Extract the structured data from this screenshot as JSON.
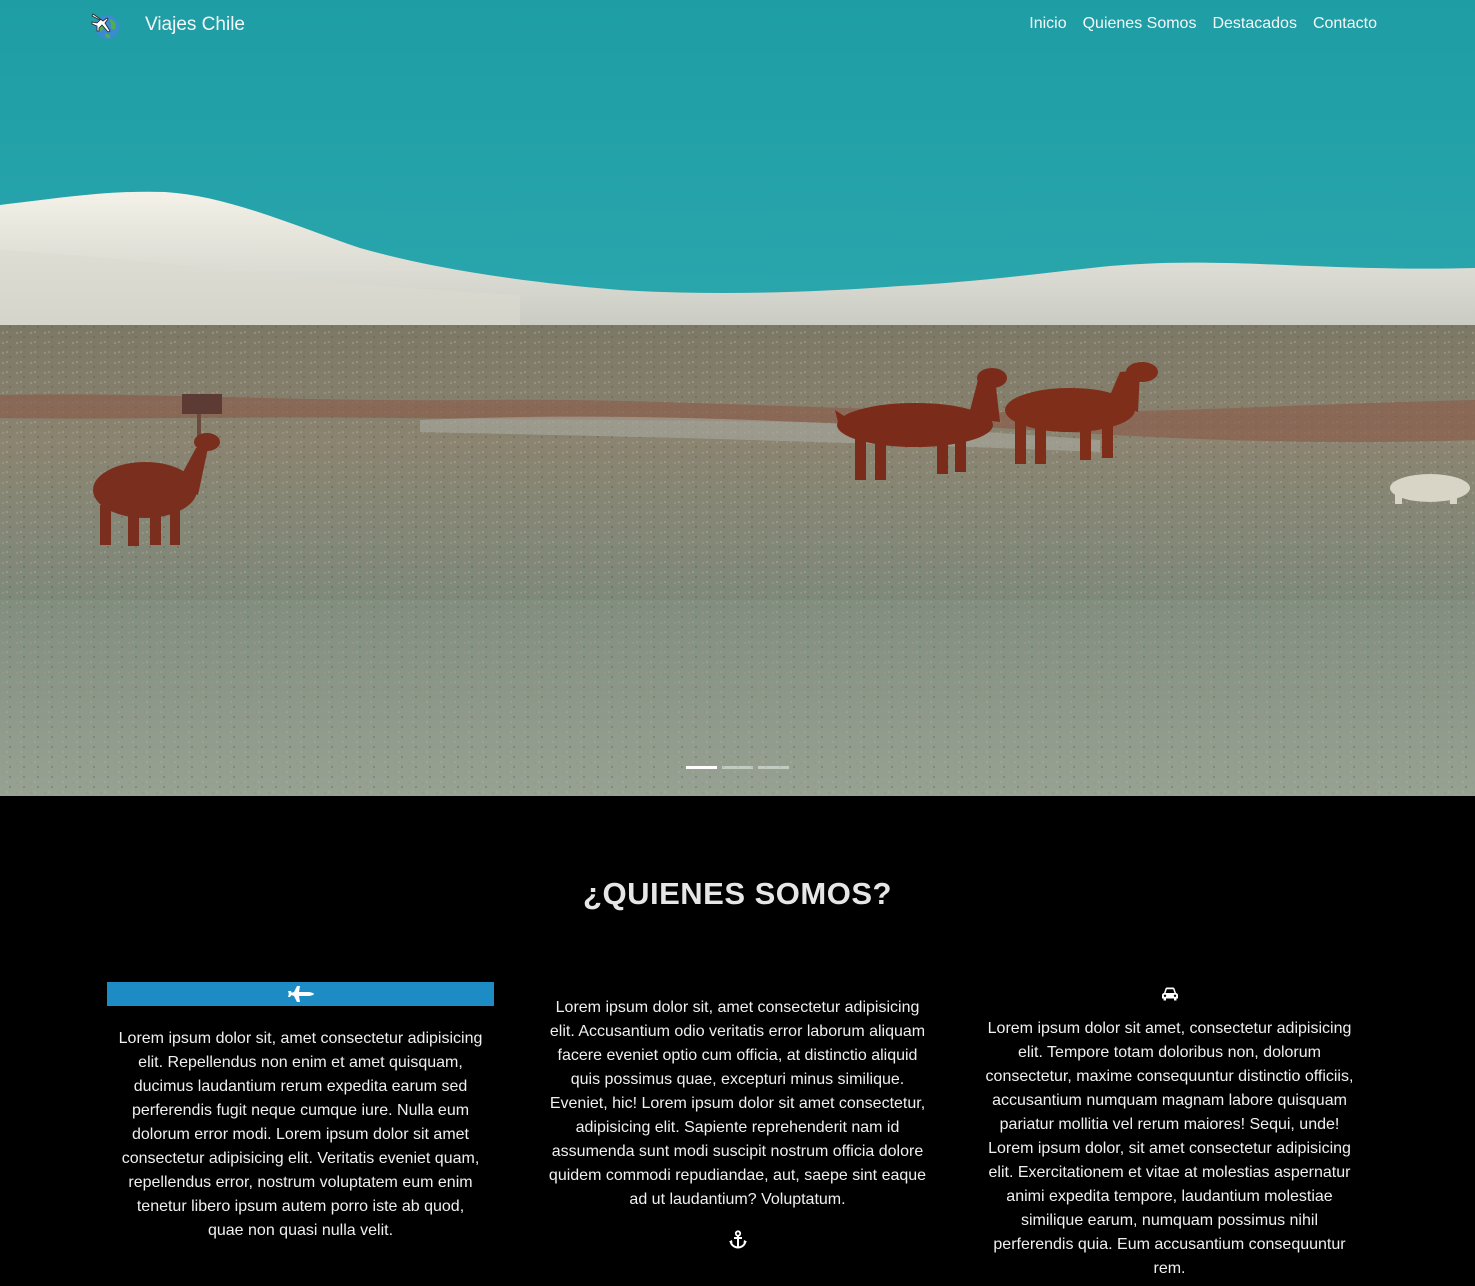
{
  "brand": {
    "name": "Viajes Chile",
    "logo": "globe-airplane-logo"
  },
  "nav": {
    "items": [
      {
        "label": "Inicio"
      },
      {
        "label": "Quienes Somos"
      },
      {
        "label": "Destacados"
      },
      {
        "label": "Contacto"
      }
    ]
  },
  "carousel": {
    "slide_count": 3,
    "active_index": 0,
    "image": "llamas-in-altiplano-photo"
  },
  "about": {
    "title": "¿QUIENES SOMOS?",
    "accent_color": "#1e8cc4",
    "columns": [
      {
        "icon": "airplane-icon",
        "text": "Lorem ipsum dolor sit, amet consectetur adipisicing elit. Repellendus non enim et amet quisquam, ducimus laudantium rerum expedita earum sed perferendis fugit neque cumque iure. Nulla eum dolorum error modi. Lorem ipsum dolor sit amet consectetur adipisicing elit. Veritatis eveniet quam, repellendus error, nostrum voluptatem eum enim tenetur libero ipsum autem porro iste ab quod, quae non quasi nulla velit."
      },
      {
        "icon": "anchor-icon",
        "text": "Lorem ipsum dolor sit, amet consectetur adipisicing elit. Accusantium odio veritatis error laborum aliquam facere eveniet optio cum officia, at distinctio aliquid quis possimus quae, excepturi minus similique. Eveniet, hic! Lorem ipsum dolor sit amet consectetur, adipisicing elit. Sapiente reprehenderit nam id assumenda sunt modi suscipit nostrum officia dolore quidem commodi repudiandae, aut, saepe sint eaque ad ut laudantium? Voluptatum."
      },
      {
        "icon": "car-icon",
        "text": "Lorem ipsum dolor sit amet, consectetur adipisicing elit. Tempore totam doloribus non, dolorum consectetur, maxime consequuntur distinctio officiis, accusantium numquam magnam labore quisquam pariatur mollitia vel rerum maiores! Sequi, unde! Lorem ipsum dolor, sit amet consectetur adipisicing elit. Exercitationem et vitae at molestias aspernatur animi expedita tempore, laudantium molestiae similique earum, numquam possimus nihil perferendis quia. Eum accusantium consequuntur rem."
      }
    ]
  }
}
